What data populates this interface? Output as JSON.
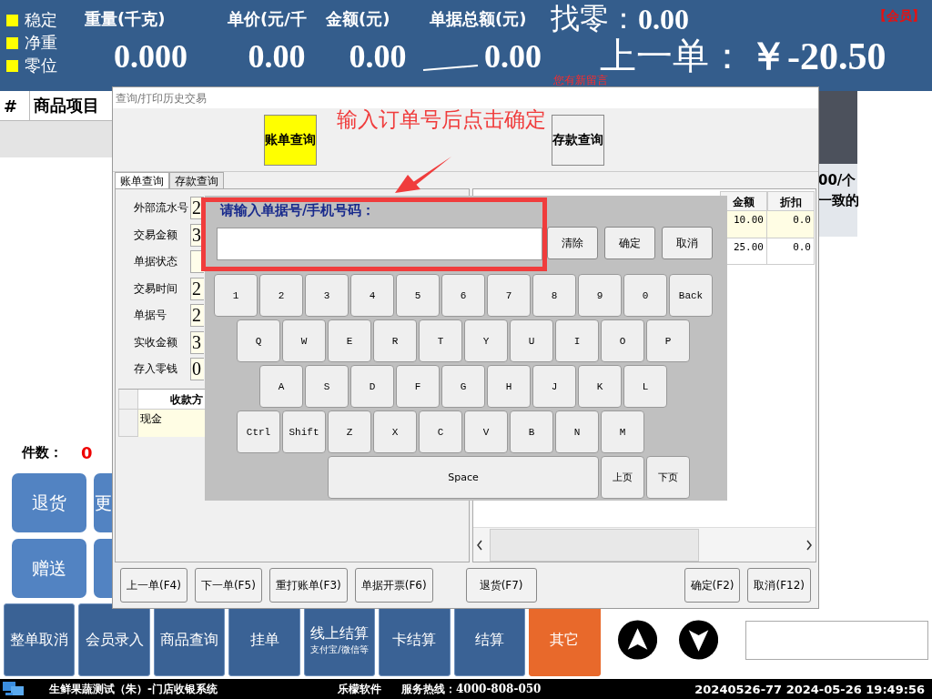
{
  "scale_status": [
    {
      "label": "稳定",
      "on": true
    },
    {
      "label": "净重",
      "on": true
    },
    {
      "label": "零位",
      "on": true
    }
  ],
  "readings": [
    {
      "label": "重量(千克)",
      "value": "0.000"
    },
    {
      "label": "单价(元/千",
      "value": "0.00"
    },
    {
      "label": "金额(元)",
      "value": "0.00"
    },
    {
      "label": "单据总额(元)",
      "value": "0.00",
      "struck_out": true
    }
  ],
  "change": {
    "label": "找零：",
    "value": "0.00"
  },
  "member_badge": "【会员】",
  "last_order": {
    "label": "上一单：",
    "value": "￥-20.50"
  },
  "message_notice": "您有新留言",
  "item_table": {
    "columns": [
      "#",
      "商品项目"
    ]
  },
  "product_card": {
    "lines": [
      "00/个",
      "一致的"
    ]
  },
  "item_count": {
    "label": "件数：",
    "value": "0"
  },
  "side_buttons": [
    {
      "kind": "full",
      "label": "退货"
    },
    {
      "kind": "partial",
      "label": "更"
    },
    {
      "kind": "full",
      "label": "赠送"
    },
    {
      "kind": "partial"
    }
  ],
  "function_buttons": [
    {
      "kind": "standard",
      "label": "整单取消"
    },
    {
      "kind": "standard",
      "label": "会员录入"
    },
    {
      "kind": "standard",
      "label": "商品查询"
    },
    {
      "kind": "standard",
      "label": "挂单"
    },
    {
      "kind": "standard",
      "label": "线上结算",
      "sublabel": "支付宝/微信等"
    },
    {
      "kind": "standard",
      "label": "卡结算"
    },
    {
      "kind": "standard",
      "label": "结算"
    },
    {
      "kind": "highlight",
      "label": "其它"
    }
  ],
  "nav_buttons": [
    {
      "kind": "up"
    },
    {
      "kind": "down"
    }
  ],
  "status_bar": {
    "store": "生鲜果蔬测试（朱）-门店收银系统",
    "vendor": "乐檬软件",
    "hotline": "服务热线：4000-808-050",
    "order_time": "20240526-77 2024-05-26 19:49:56"
  },
  "dialog": {
    "title": "查询/打印历史交易",
    "mode_buttons": [
      {
        "label": "账单查询",
        "selected": true
      },
      {
        "label": "存款查询",
        "selected": false
      }
    ],
    "tabs": [
      {
        "label": "账单查询",
        "selected": true
      },
      {
        "label": "存款查询",
        "selected": false
      }
    ],
    "fields": [
      {
        "label": "外部流水号",
        "value": "2"
      },
      {
        "label": "交易金额",
        "value": "3"
      },
      {
        "label": "单据状态"
      },
      {
        "label": "交易时间",
        "value": "2"
      },
      {
        "label": "单据号",
        "value": "2"
      },
      {
        "label": "实收金额",
        "value": "3"
      },
      {
        "label": "存入零钱",
        "value": "0"
      }
    ],
    "payment_table": {
      "columns": [
        "收款方"
      ],
      "rows": [
        [
          "现金"
        ]
      ]
    },
    "detail_table": {
      "columns": [
        "金额",
        "折扣"
      ],
      "rows": [
        {
          "cells": [
            "10.00",
            "0.0"
          ],
          "selected": true
        },
        {
          "cells": [
            "25.00",
            "0.0"
          ],
          "selected": false
        }
      ]
    },
    "buttons": [
      "上一单(F4)",
      "下一单(F5)",
      "重打账单(F3)",
      "单据开票(F6)",
      "退货(F7)",
      "确定(F2)",
      "取消(F12)"
    ]
  },
  "input_popup": {
    "prompt": "请输入单据号/手机号码：",
    "actions": [
      "清除",
      "确定",
      "取消"
    ],
    "keyboard": [
      {
        "kind": "standard",
        "keys": [
          "1",
          "2",
          "3",
          "4",
          "5",
          "6",
          "7",
          "8",
          "9",
          "0",
          "Back"
        ]
      },
      {
        "kind": "standard",
        "keys": [
          "Q",
          "W",
          "E",
          "R",
          "T",
          "Y",
          "U",
          "I",
          "O",
          "P"
        ]
      },
      {
        "kind": "standard",
        "keys": [
          "A",
          "S",
          "D",
          "F",
          "G",
          "H",
          "J",
          "K",
          "L"
        ]
      },
      {
        "kind": "standard",
        "keys": [
          "Ctrl",
          "Shift",
          "Z",
          "X",
          "C",
          "V",
          "B",
          "N",
          "M"
        ]
      },
      {
        "kind": "space",
        "keys": [
          "Space",
          "上页",
          "下页"
        ]
      }
    ]
  },
  "annotation": {
    "text": "输入订单号后点击确定"
  }
}
